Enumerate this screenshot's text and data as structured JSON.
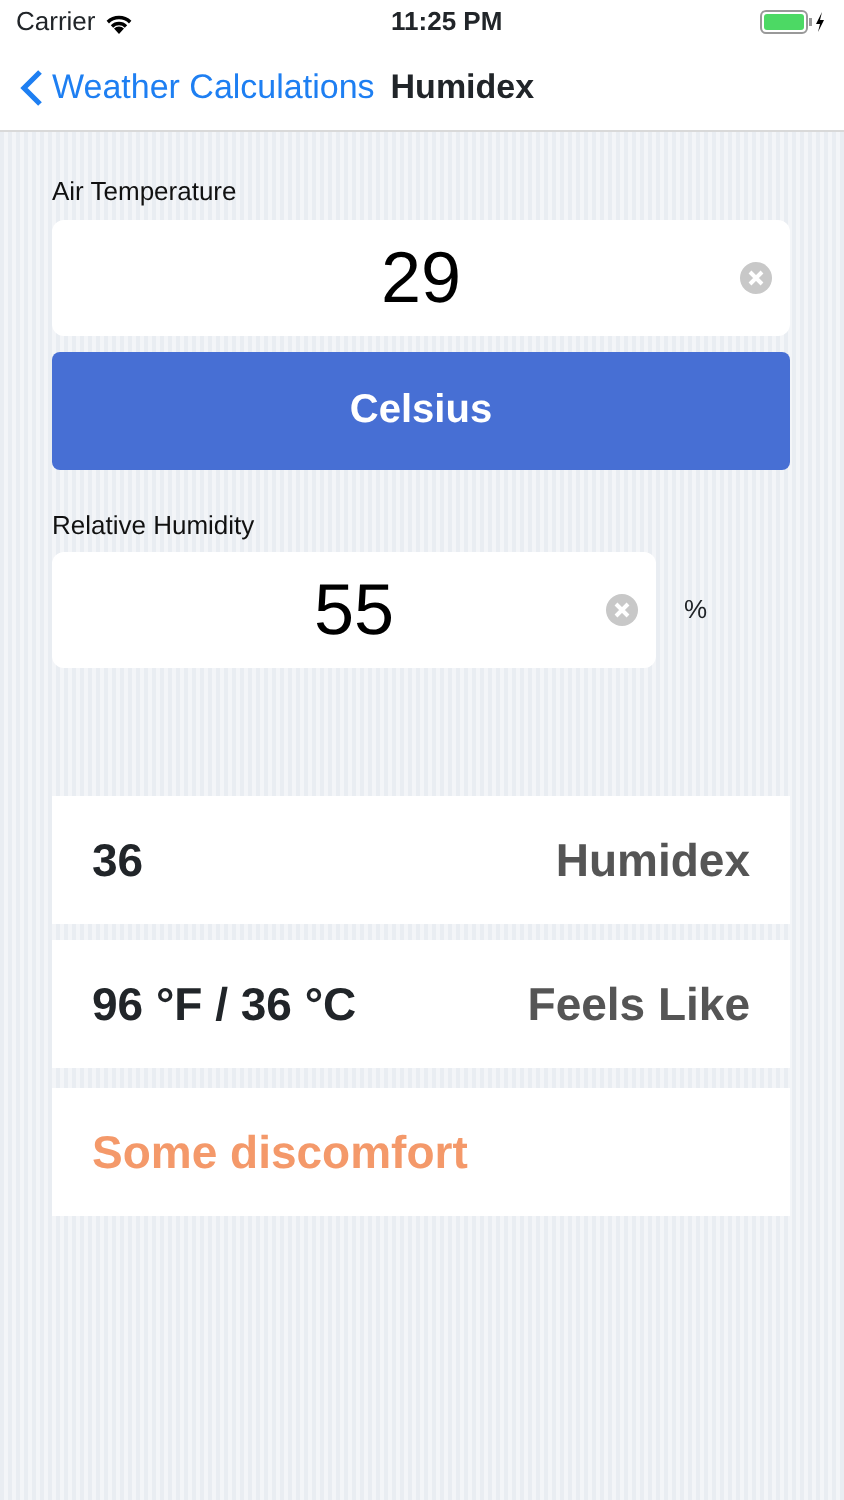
{
  "status_bar": {
    "carrier": "Carrier",
    "time": "11:25 PM"
  },
  "nav": {
    "back": "Weather Calculations",
    "title": "Humidex"
  },
  "temperature": {
    "label": "Air Temperature",
    "value": "29",
    "unit_button": "Celsius"
  },
  "humidity": {
    "label": "Relative Humidity",
    "value": "55",
    "unit": "%"
  },
  "results": [
    {
      "value": "36",
      "label": "Humidex"
    },
    {
      "value": "96 °F / 36 °C",
      "label": "Feels Like"
    }
  ],
  "comfort": {
    "text": "Some discomfort",
    "color": "#f4996a"
  }
}
